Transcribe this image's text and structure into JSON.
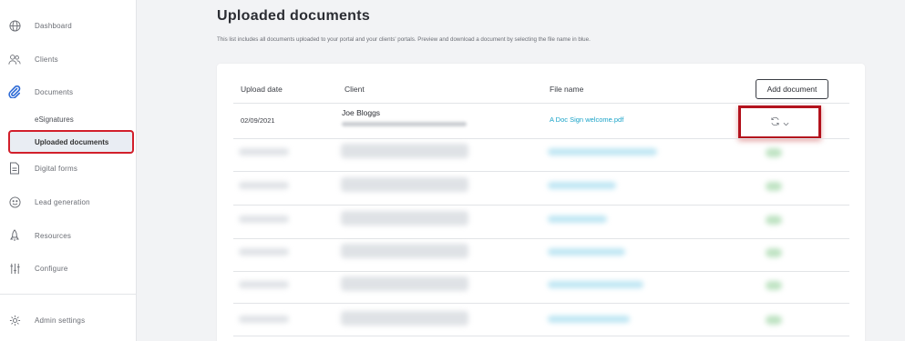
{
  "sidebar": {
    "items": [
      {
        "label": "Dashboard",
        "icon": "globe-icon"
      },
      {
        "label": "Clients",
        "icon": "users-icon"
      },
      {
        "label": "Documents",
        "icon": "paperclip-icon"
      },
      {
        "label": "Digital forms",
        "icon": "form-icon"
      },
      {
        "label": "Lead generation",
        "icon": "smiley-icon"
      },
      {
        "label": "Resources",
        "icon": "rocket-icon"
      },
      {
        "label": "Configure",
        "icon": "sliders-icon"
      },
      {
        "label": "Admin settings",
        "icon": "gear-icon"
      }
    ],
    "sub_items": {
      "esignatures": "eSignatures",
      "uploaded": "Uploaded documents"
    }
  },
  "main": {
    "title": "Uploaded documents",
    "description": "This list includes all documents uploaded to your portal and your clients' portals. Preview and download a document by selecting the file name in blue."
  },
  "table": {
    "headers": {
      "upload_date": "Upload date",
      "client": "Client",
      "file_name": "File name"
    },
    "add_button": "Add document",
    "rows": [
      {
        "date": "02/09/2021",
        "client": "Joe Bloggs",
        "file": "A Doc Sign welcome.pdf"
      }
    ]
  },
  "colors": {
    "accent_link": "#1aa3c8",
    "highlight_red": "#d21f2b"
  }
}
